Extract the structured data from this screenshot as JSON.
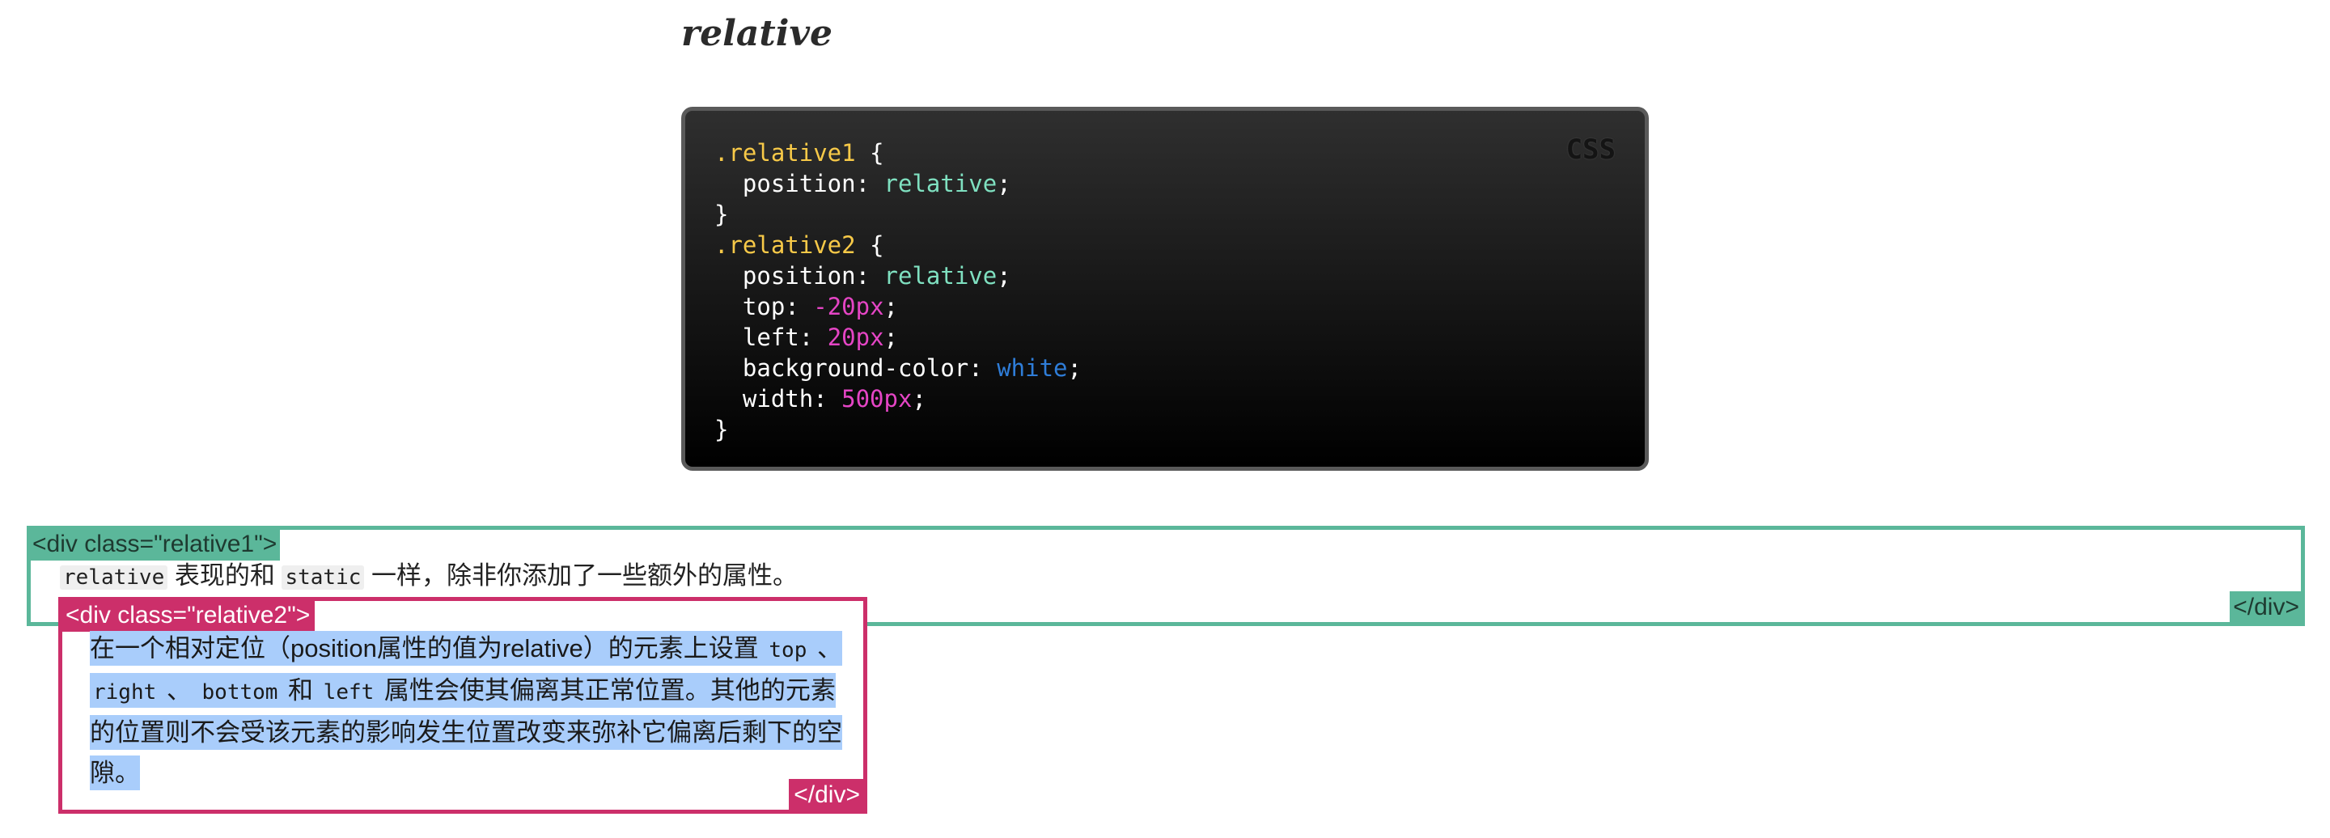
{
  "heading": "relative",
  "code_block": {
    "lang": "CSS",
    "lines": [
      [
        {
          "t": ".relative1",
          "c": "sel"
        },
        {
          "t": " {",
          "c": "punct"
        }
      ],
      [
        {
          "t": "  position",
          "c": "prop"
        },
        {
          "t": ": ",
          "c": "punct"
        },
        {
          "t": "relative",
          "c": "kw"
        },
        {
          "t": ";",
          "c": "punct"
        }
      ],
      [
        {
          "t": "}",
          "c": "punct"
        }
      ],
      [
        {
          "t": ".relative2",
          "c": "sel"
        },
        {
          "t": " {",
          "c": "punct"
        }
      ],
      [
        {
          "t": "  position",
          "c": "prop"
        },
        {
          "t": ": ",
          "c": "punct"
        },
        {
          "t": "relative",
          "c": "kw"
        },
        {
          "t": ";",
          "c": "punct"
        }
      ],
      [
        {
          "t": "  top",
          "c": "prop"
        },
        {
          "t": ": ",
          "c": "punct"
        },
        {
          "t": "-20px",
          "c": "num"
        },
        {
          "t": ";",
          "c": "punct"
        }
      ],
      [
        {
          "t": "  left",
          "c": "prop"
        },
        {
          "t": ": ",
          "c": "punct"
        },
        {
          "t": "20px",
          "c": "num"
        },
        {
          "t": ";",
          "c": "punct"
        }
      ],
      [
        {
          "t": "  background-color",
          "c": "prop"
        },
        {
          "t": ": ",
          "c": "punct"
        },
        {
          "t": "white",
          "c": "color"
        },
        {
          "t": ";",
          "c": "punct"
        }
      ],
      [
        {
          "t": "  width",
          "c": "prop"
        },
        {
          "t": ": ",
          "c": "punct"
        },
        {
          "t": "500px",
          "c": "num"
        },
        {
          "t": ";",
          "c": "punct"
        }
      ],
      [
        {
          "t": "}",
          "c": "punct"
        }
      ]
    ]
  },
  "demo": {
    "outer_open_tag": "<div class=\"relative1\">",
    "outer_close_tag": "</div>",
    "outer_text": [
      {
        "t": "relative",
        "code": true
      },
      {
        "t": " 表现的和 ",
        "code": false
      },
      {
        "t": "static",
        "code": true
      },
      {
        "t": " 一样，除非你添加了一些额外的属性。",
        "code": false
      }
    ],
    "inner_open_tag": "<div class=\"relative2\">",
    "inner_close_tag": "</div>",
    "inner_text": [
      {
        "t": "在一个相对定位（position属性的值为relative）的元素上设置 ",
        "code": false
      },
      {
        "t": "top",
        "code": true
      },
      {
        "t": " 、 ",
        "code": false
      },
      {
        "t": "right",
        "code": true
      },
      {
        "t": " 、 ",
        "code": false
      },
      {
        "t": "bottom",
        "code": true
      },
      {
        "t": " 和 ",
        "code": false
      },
      {
        "t": "left",
        "code": true
      },
      {
        "t": " 属性会使其偏离其正常位置。其他的元素的位置则不会受该元素的影响发生位置改变来弥补它偏离后剩下的空隙。",
        "code": false
      }
    ]
  },
  "colors": {
    "outer_border": "#5bb79a",
    "inner_border": "#cc2f6a",
    "selection_highlight": "#a9cdfb"
  }
}
